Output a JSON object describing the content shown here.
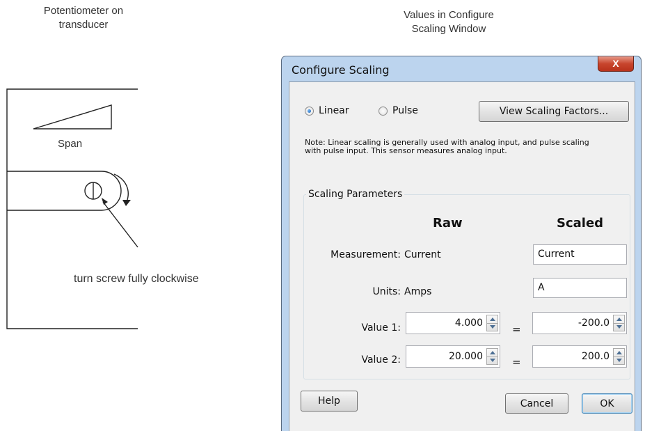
{
  "captions": {
    "left": [
      "Potentiometer on",
      "transducer"
    ],
    "right": [
      "Values in Configure",
      "Scaling Window"
    ]
  },
  "diagram": {
    "span_label": "Span",
    "screw_label": "turn screw fully clockwise"
  },
  "dialog": {
    "title": "Configure Scaling",
    "close_glyph": "X",
    "radios": {
      "linear": {
        "label": "Linear",
        "checked": true
      },
      "pulse": {
        "label": "Pulse",
        "checked": false
      }
    },
    "view_button": "View Scaling Factors...",
    "note": "Note: Linear scaling is generally used with analog input, and pulse scaling with pulse input. This sensor measures analog input.",
    "group_label": "Scaling Parameters",
    "headers": {
      "raw": "Raw",
      "scaled": "Scaled"
    },
    "measurement": {
      "label": "Measurement:",
      "raw": "Current",
      "scaled": "Current"
    },
    "units": {
      "label": "Units:",
      "raw": "Amps",
      "scaled": "A"
    },
    "value1": {
      "label": "Value 1:",
      "raw": "4.000",
      "eq": "=",
      "scaled": "-200.0"
    },
    "value2": {
      "label": "Value 2:",
      "raw": "20.000",
      "eq": "=",
      "scaled": "200.0"
    },
    "buttons": {
      "help": "Help",
      "cancel": "Cancel",
      "ok": "OK"
    }
  }
}
